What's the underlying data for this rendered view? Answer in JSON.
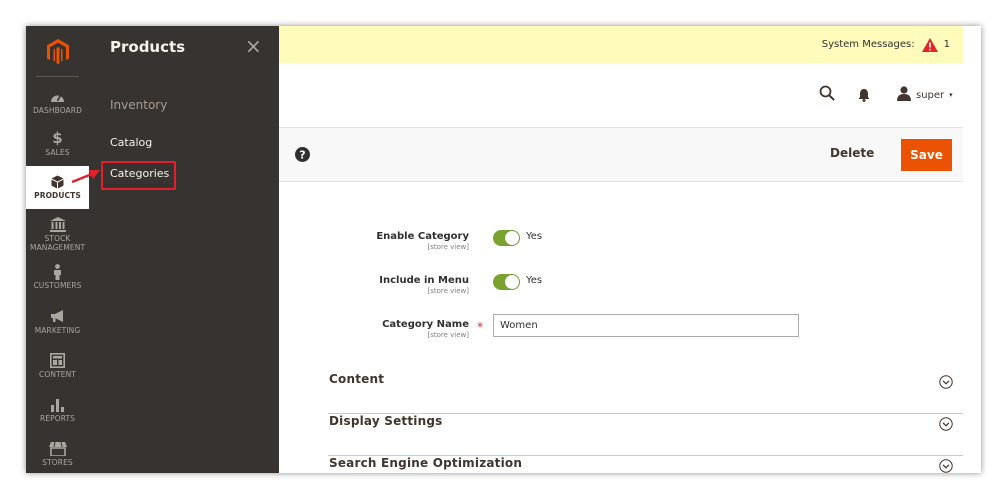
{
  "nav": {
    "items": [
      {
        "label": "Dashboard",
        "icon": "dashboard-icon"
      },
      {
        "label": "Sales",
        "icon": "dollar-icon"
      },
      {
        "label": "Products",
        "icon": "cube-icon"
      },
      {
        "label": "Stock Management",
        "icon": "bank-icon"
      },
      {
        "label": "Customers",
        "icon": "person-icon"
      },
      {
        "label": "Marketing",
        "icon": "megaphone-icon"
      },
      {
        "label": "Content",
        "icon": "layout-icon"
      },
      {
        "label": "Reports",
        "icon": "bar-chart-icon"
      },
      {
        "label": "Stores",
        "icon": "store-icon"
      }
    ],
    "active": "Products"
  },
  "flyout": {
    "title": "Products",
    "close_label": "×",
    "section_heading": "Inventory",
    "links": [
      {
        "label": "Catalog"
      },
      {
        "label": "Categories"
      }
    ]
  },
  "system_messages": {
    "label": "System Messages:",
    "count": "1"
  },
  "header": {
    "username": "super",
    "caret": "▾"
  },
  "actions": {
    "delete_label": "Delete",
    "save_label": "Save",
    "help_label": "?"
  },
  "form": {
    "enable_category": {
      "label": "Enable Category",
      "scope": "[store view]",
      "value": "Yes"
    },
    "include_in_menu": {
      "label": "Include in Menu",
      "scope": "[store view]",
      "value": "Yes"
    },
    "category_name": {
      "label": "Category Name",
      "scope": "[store view]",
      "value": "Women",
      "required_mark": "*"
    }
  },
  "sections": [
    {
      "title": "Content"
    },
    {
      "title": "Display Settings"
    },
    {
      "title": "Search Engine Optimization"
    }
  ],
  "colors": {
    "nav_bg": "#373330",
    "accent": "#eb5202",
    "toggle_on": "#79a22e",
    "message_bar": "#fffbbb",
    "highlight": "#e3202b"
  }
}
